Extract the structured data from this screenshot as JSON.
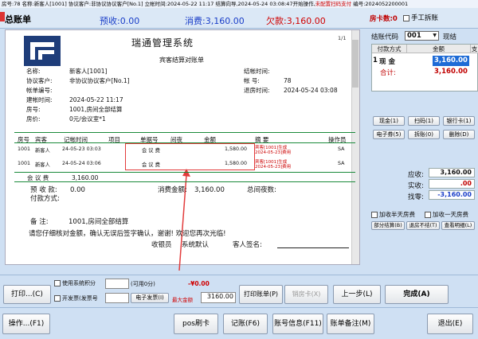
{
  "titlebar": {
    "text": "房号:78 名称:新客人[1001] 协议客户:非协议协议客户[No.1] 立帐时间:2024-05-22 11:17 结算向导,2024-05-24 03:08:47开始操作,",
    "warning": "未配置扫码支付",
    "tail": " 编号:2024052200001"
  },
  "header": {
    "title": "总账单",
    "deposit": "预收:0.00",
    "consumption": "消费:3,160.00",
    "owed": "欠款:3,160.00",
    "room_cards": "房卡数:0",
    "manual_split": "手工拆账"
  },
  "doc": {
    "company": "瑞通管理系统",
    "subtitle": "宾客结算对账单",
    "page": "1/1",
    "fields": {
      "name_label": "名称:",
      "name": "新客人[1001]",
      "agreement_label": "协议客户:",
      "agreement": "非协议协议客户[No.1]",
      "account_label": "帐单编号:",
      "account": "",
      "created_label": "建帐时间:",
      "created": "2024-05-22 11:17",
      "room_label": "房号:",
      "room": "1001,房间全部结算",
      "price_label": "房价:",
      "price": "0元/会议室*1",
      "checkout_label": "结帐时间:",
      "checkout": "",
      "acct_no_label": "帐    号:",
      "acct_no": "78",
      "leave_label": "退房时间:",
      "leave": "2024-05-24 03:08"
    },
    "columns": [
      "房号",
      "宾客",
      "记帐时间",
      "项目",
      "单据号",
      "间夜",
      "金额",
      "摘    要",
      "操作员"
    ],
    "rows": [
      {
        "room": "1001",
        "guest": "新客人",
        "time": "24-05-23 03:03",
        "item": "会 议 费",
        "doc": "",
        "nights": "",
        "amount": "1,580.00",
        "summary_1": "宾客[1001]生成",
        "summary_2": "2024-05-23]费用",
        "op": "SA"
      },
      {
        "room": "1001",
        "guest": "新客人",
        "time": "24-05-24 03:06",
        "item": "会 议 费",
        "doc": "",
        "nights": "",
        "amount": "1,580.00",
        "summary_1": "宾客[1001]生成",
        "summary_2": "2024-05-23]费用",
        "op": "SA"
      }
    ],
    "subtotal_label": "会 议 费",
    "subtotal": "3,160.00",
    "prepaid_label": "预 收 款:",
    "prepaid": "0.00",
    "consumed_label": "消费金额:",
    "consumed": "3,160.00",
    "nights_label": "总间夜数:",
    "nights_total": "",
    "pay_label": "付款方式:",
    "remark_label": "备    注:",
    "remark": "1001,房间全部结算",
    "notice": "请您仔细核对金额，确认无误后签字确认，谢谢! 欢迎您再次光临!",
    "cashier_label": "收银员",
    "cashier": "系统默认",
    "sign_label": "客人签名:"
  },
  "right": {
    "code_label": "结账代码",
    "code_value": "001",
    "cash_label": "现结",
    "grid_headers": [
      "付款方式",
      "金额",
      "支"
    ],
    "grid_row_index": "1",
    "grid_row_method": "现 金",
    "grid_row_amount": "3,160.00",
    "total_label": "合计:",
    "total_value": "3,160.00",
    "buttons": [
      "现金(1)",
      "扫码(1)",
      "银行卡(1)",
      "电子券(5)",
      "拆账(0)",
      "删除(D)"
    ],
    "receivable_label": "应收:",
    "receivable": "3,160.00",
    "received_label": "实收:",
    "received": ".00",
    "change_label": "找零:",
    "change": "-3,160.00",
    "half_day": "加收半天房费",
    "full_day": "加收一天房费",
    "small_buttons": [
      "部分结算(B)",
      "退房不结(T)",
      "查看明细(L)"
    ]
  },
  "bottom": {
    "print": "打印...(C)",
    "use_points": "使用系统积分",
    "points_avail": "(可用0分)",
    "points_amount": "-¥0.00",
    "invoice": "开发票(发票号",
    "e_invoice": "电子发票(I)",
    "max_amount": "最大金额",
    "max_value": "3160.00",
    "print_bill": "打印账单(P)",
    "room_card": "销房卡(X)",
    "prev": "上一步(L)",
    "finish": "完成(A)",
    "ops": "操作...(F1)",
    "pos": "pos刷卡",
    "record": "记账(F6)",
    "acct_info": "账号信息(F11)",
    "bill_note": "账单备注(M)",
    "exit": "退出(E)"
  }
}
